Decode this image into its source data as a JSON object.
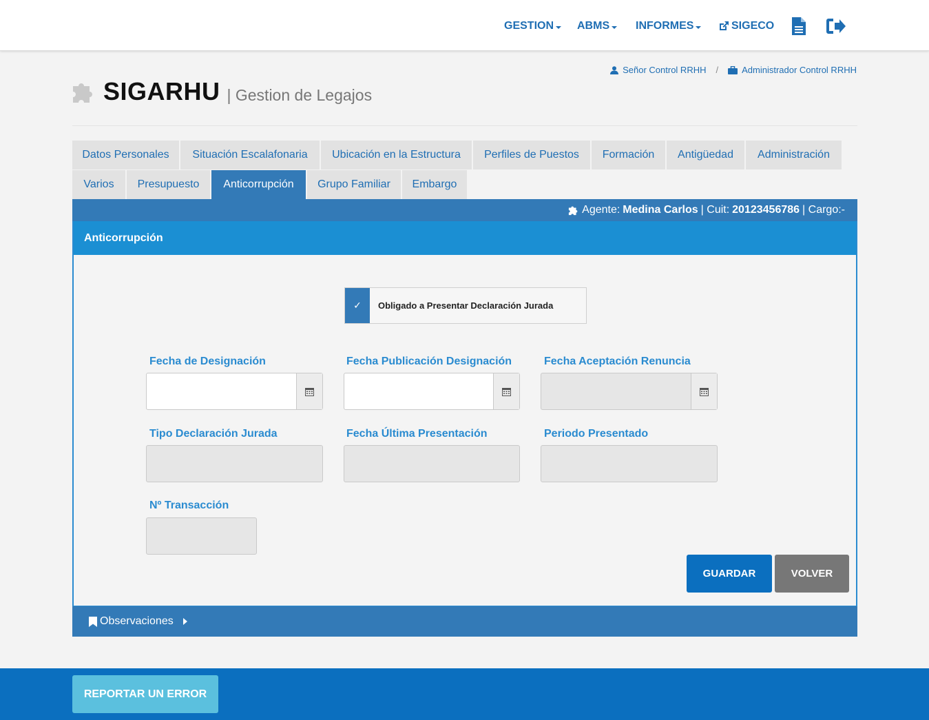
{
  "nav": {
    "gestion": "GESTION",
    "abms": "ABMS",
    "informes": "INFORMES",
    "sigeco": "SIGECO"
  },
  "user": {
    "name": "Señor Control RRHH",
    "separator": "/",
    "role": "Administrador Control RRHH"
  },
  "brand": {
    "title": "SIGARHU",
    "subtitle": "| Gestion de Legajos"
  },
  "tabs_row1": [
    "Datos Personales",
    "Situación Escalafonaria",
    "Ubicación en la Estructura",
    "Perfiles de Puestos",
    "Formación",
    "Antigüedad",
    "Administración"
  ],
  "tabs_row2": [
    "Varios",
    "Presupuesto",
    "Anticorrupción",
    "Grupo Familiar",
    "Embargo"
  ],
  "active_tab": "Anticorrupción",
  "agent": {
    "agent_label": "Agente:",
    "agent_name": "Medina Carlos",
    "cuit_label": "| Cuit:",
    "cuit_value": "20123456786",
    "cargo_label": "| Cargo:-"
  },
  "panel": {
    "title": "Anticorrupción",
    "checkbox_label": "Obligado a Presentar Declaración Jurada",
    "checkbox_checked": true,
    "check_mark": "✓"
  },
  "fields": {
    "fecha_designacion": {
      "label": "Fecha de Designación",
      "value": ""
    },
    "fecha_publicacion": {
      "label": "Fecha Publicación Designación",
      "value": ""
    },
    "fecha_aceptacion": {
      "label": "Fecha Aceptación Renuncia",
      "value": ""
    },
    "tipo_declaracion": {
      "label": "Tipo Declaración Jurada",
      "value": ""
    },
    "fecha_ultima": {
      "label": "Fecha Última Presentación",
      "value": ""
    },
    "periodo": {
      "label": "Periodo Presentado",
      "value": ""
    },
    "transaccion": {
      "label": "Nº Transacción",
      "value": ""
    }
  },
  "buttons": {
    "guardar": "GUARDAR",
    "volver": "VOLVER"
  },
  "observaciones": "Observaciones",
  "footer": {
    "report": "REPORTAR UN ERROR"
  },
  "colors": {
    "primary": "#337ab7",
    "header_blue": "#1b8fd3",
    "label_blue": "#2a8bd0",
    "link_blue": "#1f6eb3",
    "save": "#0b6fbf",
    "back": "#777777",
    "footer": "#0b6fbf",
    "report": "#5bc0de"
  }
}
